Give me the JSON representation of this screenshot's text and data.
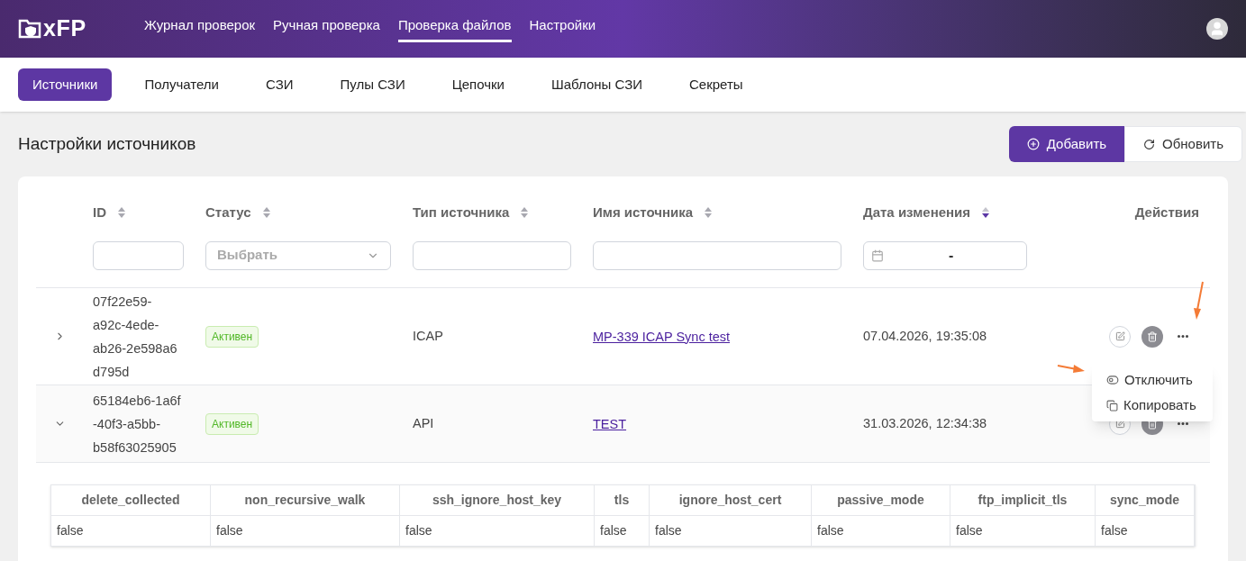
{
  "logo": {
    "text": "xFP"
  },
  "nav": [
    {
      "label": "Журнал проверок",
      "selected": false
    },
    {
      "label": "Ручная проверка",
      "selected": false
    },
    {
      "label": "Проверка файлов",
      "selected": true
    },
    {
      "label": "Настройки",
      "selected": false
    }
  ],
  "subtabs": [
    {
      "label": "Источники",
      "selected": true
    },
    {
      "label": "Получатели",
      "selected": false
    },
    {
      "label": "СЗИ",
      "selected": false
    },
    {
      "label": "Пулы СЗИ",
      "selected": false
    },
    {
      "label": "Цепочки",
      "selected": false
    },
    {
      "label": "Шаблоны СЗИ",
      "selected": false
    },
    {
      "label": "Секреты",
      "selected": false
    }
  ],
  "page_title": "Настройки источников",
  "buttons": [
    {
      "label": "Добавить",
      "kind": "primary"
    },
    {
      "label": "Обновить",
      "kind": "secondary"
    }
  ],
  "table": {
    "columns": [
      {
        "label": "ID",
        "sortable": true,
        "sorted": false
      },
      {
        "label": "Статус",
        "sortable": true,
        "sorted": false
      },
      {
        "label": "Тип источника",
        "sortable": true,
        "sorted": false
      },
      {
        "label": "Имя источника",
        "sortable": true,
        "sorted": false
      },
      {
        "label": "Дата изменения",
        "sortable": true,
        "sorted": true
      },
      {
        "label": "Действия",
        "sortable": false
      }
    ],
    "filters": {
      "status_placeholder": "Выбрать",
      "date_separator": "-"
    },
    "rows": [
      {
        "expanded": false,
        "id": "07f22e59-\na92c-4ede-\nab26-2e598a6\nd795d",
        "status": "Активен",
        "type": "ICAP",
        "name": "MP-339 ICAP Sync test",
        "date": "07.04.2026, 19:35:08"
      },
      {
        "expanded": true,
        "id": "65184eb6-1a6f\n-40f3-a5bb-\nb58f63025905",
        "status": "Активен",
        "type": "API",
        "name": "TEST",
        "date": "31.03.2026, 12:34:38"
      }
    ]
  },
  "details": {
    "columns": [
      "delete_collected",
      "non_recursive_walk",
      "ssh_ignore_host_key",
      "tls",
      "ignore_host_cert",
      "passive_mode",
      "ftp_implicit_tls",
      "sync_mode"
    ],
    "values": [
      "false",
      "false",
      "false",
      "false",
      "false",
      "false",
      "false",
      "false"
    ]
  },
  "menu": {
    "items": [
      {
        "label": "Отключить",
        "kind": "toggle"
      },
      {
        "label": "Копировать",
        "kind": "copy"
      }
    ]
  }
}
